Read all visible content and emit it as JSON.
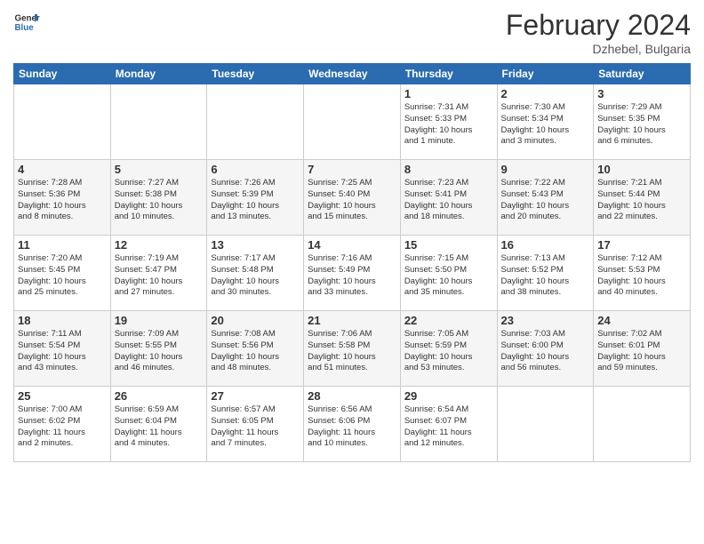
{
  "header": {
    "logo_general": "General",
    "logo_blue": "Blue",
    "month": "February 2024",
    "location": "Dzhebel, Bulgaria"
  },
  "columns": [
    "Sunday",
    "Monday",
    "Tuesday",
    "Wednesday",
    "Thursday",
    "Friday",
    "Saturday"
  ],
  "weeks": [
    {
      "days": [
        {
          "num": "",
          "info": ""
        },
        {
          "num": "",
          "info": ""
        },
        {
          "num": "",
          "info": ""
        },
        {
          "num": "",
          "info": ""
        },
        {
          "num": "1",
          "info": "Sunrise: 7:31 AM\nSunset: 5:33 PM\nDaylight: 10 hours\nand 1 minute."
        },
        {
          "num": "2",
          "info": "Sunrise: 7:30 AM\nSunset: 5:34 PM\nDaylight: 10 hours\nand 3 minutes."
        },
        {
          "num": "3",
          "info": "Sunrise: 7:29 AM\nSunset: 5:35 PM\nDaylight: 10 hours\nand 6 minutes."
        }
      ]
    },
    {
      "days": [
        {
          "num": "4",
          "info": "Sunrise: 7:28 AM\nSunset: 5:36 PM\nDaylight: 10 hours\nand 8 minutes."
        },
        {
          "num": "5",
          "info": "Sunrise: 7:27 AM\nSunset: 5:38 PM\nDaylight: 10 hours\nand 10 minutes."
        },
        {
          "num": "6",
          "info": "Sunrise: 7:26 AM\nSunset: 5:39 PM\nDaylight: 10 hours\nand 13 minutes."
        },
        {
          "num": "7",
          "info": "Sunrise: 7:25 AM\nSunset: 5:40 PM\nDaylight: 10 hours\nand 15 minutes."
        },
        {
          "num": "8",
          "info": "Sunrise: 7:23 AM\nSunset: 5:41 PM\nDaylight: 10 hours\nand 18 minutes."
        },
        {
          "num": "9",
          "info": "Sunrise: 7:22 AM\nSunset: 5:43 PM\nDaylight: 10 hours\nand 20 minutes."
        },
        {
          "num": "10",
          "info": "Sunrise: 7:21 AM\nSunset: 5:44 PM\nDaylight: 10 hours\nand 22 minutes."
        }
      ]
    },
    {
      "days": [
        {
          "num": "11",
          "info": "Sunrise: 7:20 AM\nSunset: 5:45 PM\nDaylight: 10 hours\nand 25 minutes."
        },
        {
          "num": "12",
          "info": "Sunrise: 7:19 AM\nSunset: 5:47 PM\nDaylight: 10 hours\nand 27 minutes."
        },
        {
          "num": "13",
          "info": "Sunrise: 7:17 AM\nSunset: 5:48 PM\nDaylight: 10 hours\nand 30 minutes."
        },
        {
          "num": "14",
          "info": "Sunrise: 7:16 AM\nSunset: 5:49 PM\nDaylight: 10 hours\nand 33 minutes."
        },
        {
          "num": "15",
          "info": "Sunrise: 7:15 AM\nSunset: 5:50 PM\nDaylight: 10 hours\nand 35 minutes."
        },
        {
          "num": "16",
          "info": "Sunrise: 7:13 AM\nSunset: 5:52 PM\nDaylight: 10 hours\nand 38 minutes."
        },
        {
          "num": "17",
          "info": "Sunrise: 7:12 AM\nSunset: 5:53 PM\nDaylight: 10 hours\nand 40 minutes."
        }
      ]
    },
    {
      "days": [
        {
          "num": "18",
          "info": "Sunrise: 7:11 AM\nSunset: 5:54 PM\nDaylight: 10 hours\nand 43 minutes."
        },
        {
          "num": "19",
          "info": "Sunrise: 7:09 AM\nSunset: 5:55 PM\nDaylight: 10 hours\nand 46 minutes."
        },
        {
          "num": "20",
          "info": "Sunrise: 7:08 AM\nSunset: 5:56 PM\nDaylight: 10 hours\nand 48 minutes."
        },
        {
          "num": "21",
          "info": "Sunrise: 7:06 AM\nSunset: 5:58 PM\nDaylight: 10 hours\nand 51 minutes."
        },
        {
          "num": "22",
          "info": "Sunrise: 7:05 AM\nSunset: 5:59 PM\nDaylight: 10 hours\nand 53 minutes."
        },
        {
          "num": "23",
          "info": "Sunrise: 7:03 AM\nSunset: 6:00 PM\nDaylight: 10 hours\nand 56 minutes."
        },
        {
          "num": "24",
          "info": "Sunrise: 7:02 AM\nSunset: 6:01 PM\nDaylight: 10 hours\nand 59 minutes."
        }
      ]
    },
    {
      "days": [
        {
          "num": "25",
          "info": "Sunrise: 7:00 AM\nSunset: 6:02 PM\nDaylight: 11 hours\nand 2 minutes."
        },
        {
          "num": "26",
          "info": "Sunrise: 6:59 AM\nSunset: 6:04 PM\nDaylight: 11 hours\nand 4 minutes."
        },
        {
          "num": "27",
          "info": "Sunrise: 6:57 AM\nSunset: 6:05 PM\nDaylight: 11 hours\nand 7 minutes."
        },
        {
          "num": "28",
          "info": "Sunrise: 6:56 AM\nSunset: 6:06 PM\nDaylight: 11 hours\nand 10 minutes."
        },
        {
          "num": "29",
          "info": "Sunrise: 6:54 AM\nSunset: 6:07 PM\nDaylight: 11 hours\nand 12 minutes."
        },
        {
          "num": "",
          "info": ""
        },
        {
          "num": "",
          "info": ""
        }
      ]
    }
  ]
}
